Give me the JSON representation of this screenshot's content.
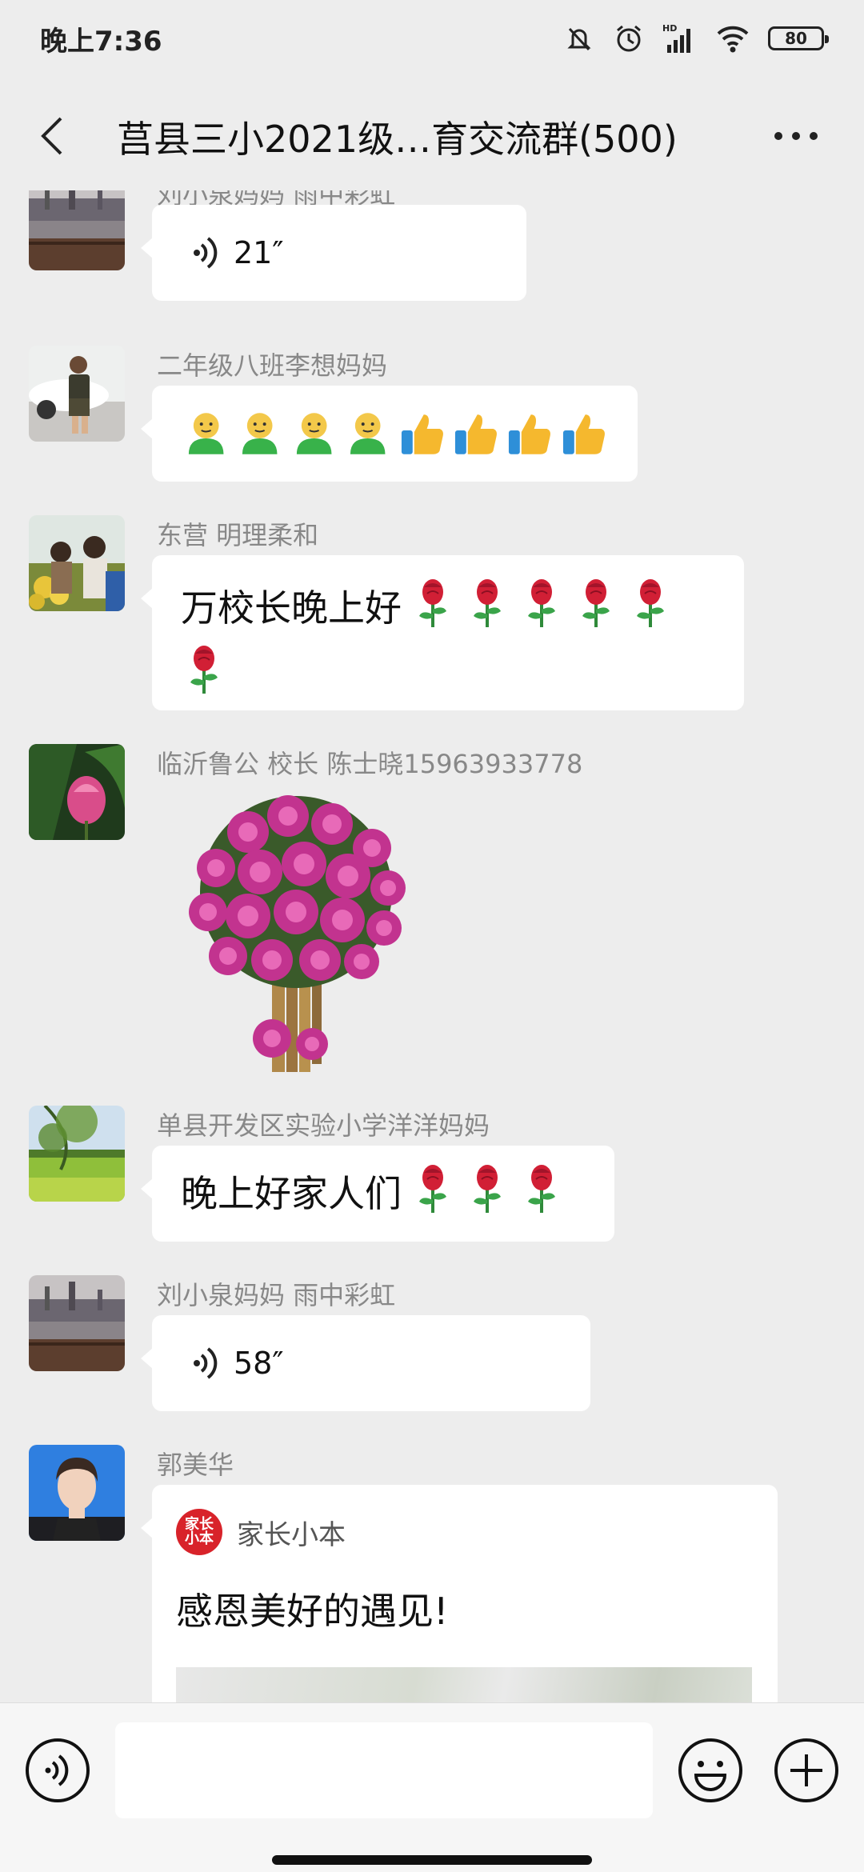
{
  "status_bar": {
    "time": "晚上7:36",
    "battery": "80",
    "icons": [
      "mute-bell-icon",
      "alarm-icon",
      "hd-signal-icon",
      "wifi-icon",
      "battery-icon"
    ]
  },
  "nav": {
    "title": "莒县三小2021级…育交流群(500)",
    "back_icon": "chevron-left-icon",
    "more_icon": "more-dots-icon"
  },
  "messages": [
    {
      "sender": "刘小泉妈妈  雨中彩虹",
      "type": "voice",
      "duration": "21″"
    },
    {
      "sender": "二年级八班李想妈妈",
      "type": "emoji",
      "emojis": [
        "smile-person",
        "smile-person",
        "smile-person",
        "smile-person",
        "thumbs-up",
        "thumbs-up",
        "thumbs-up",
        "thumbs-up"
      ]
    },
    {
      "sender": "东营  明理柔和",
      "type": "text",
      "text": "万校长晚上好",
      "rose_count": 6
    },
    {
      "sender": "临沂鲁公 校长  陈士晓15963933778",
      "type": "sticker",
      "sticker": "rose-bouquet-tree"
    },
    {
      "sender": "单县开发区实验小学洋洋妈妈",
      "type": "text",
      "text": "晚上好家人们",
      "rose_count": 3
    },
    {
      "sender": "刘小泉妈妈  雨中彩虹",
      "type": "voice",
      "duration": "58″"
    },
    {
      "sender": "郭美华",
      "type": "card",
      "source": "家长小本",
      "logo_text": "家长小本",
      "title": "感恩美好的遇见!"
    }
  ],
  "colors": {
    "background": "#ededed",
    "bubble": "#ffffff",
    "sender_text": "#888888",
    "logo_red": "#d8232a"
  },
  "input_bar": {
    "placeholder": "",
    "voice_icon": "voice-mode-icon",
    "emoji_icon": "emoji-icon",
    "plus_icon": "plus-icon"
  }
}
